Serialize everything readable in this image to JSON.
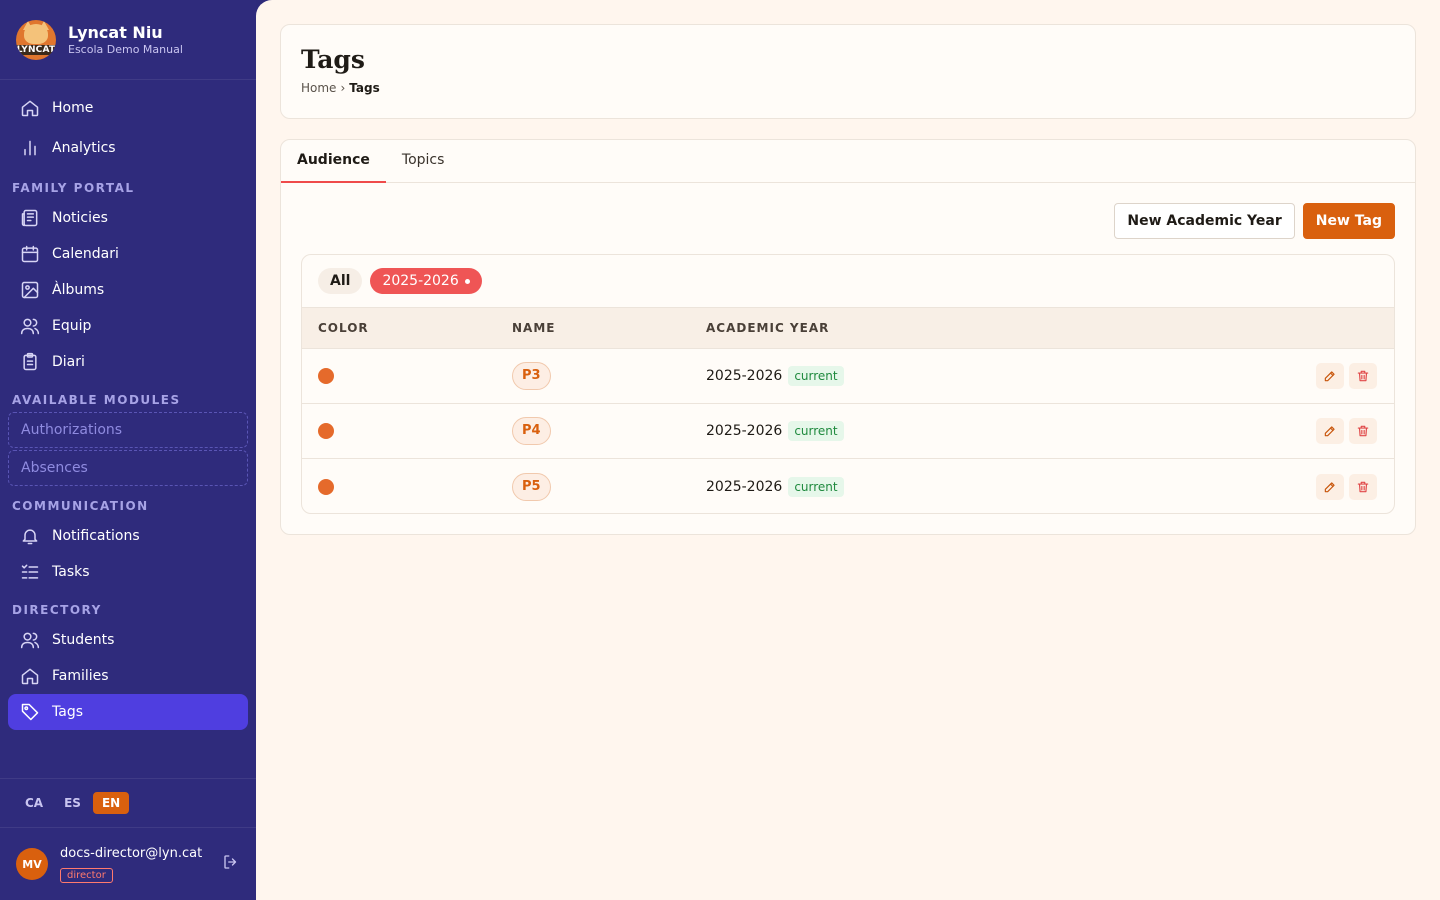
{
  "brand": {
    "logo_text": "LYNCAT",
    "title": "Lyncat Niu",
    "subtitle": "Escola Demo Manual"
  },
  "sidebar": {
    "top_items": [
      {
        "label": "Home",
        "icon": "home-icon"
      },
      {
        "label": "Analytics",
        "icon": "bar-chart-icon"
      }
    ],
    "sections": {
      "family_portal": {
        "label": "FAMILY PORTAL",
        "items": [
          {
            "label": "Noticies",
            "icon": "newspaper-icon"
          },
          {
            "label": "Calendari",
            "icon": "calendar-icon"
          },
          {
            "label": "Àlbums",
            "icon": "image-icon"
          },
          {
            "label": "Equip",
            "icon": "users-icon"
          },
          {
            "label": "Diari",
            "icon": "clipboard-icon"
          }
        ]
      },
      "available_modules": {
        "label": "AVAILABLE MODULES",
        "items": [
          {
            "label": "Authorizations"
          },
          {
            "label": "Absences"
          }
        ]
      },
      "communication": {
        "label": "COMMUNICATION",
        "items": [
          {
            "label": "Notifications",
            "icon": "bell-icon"
          },
          {
            "label": "Tasks",
            "icon": "checklist-icon"
          }
        ]
      },
      "directory": {
        "label": "DIRECTORY",
        "items": [
          {
            "label": "Students",
            "icon": "users-icon"
          },
          {
            "label": "Families",
            "icon": "home-icon"
          },
          {
            "label": "Tags",
            "icon": "tag-icon",
            "active": true
          }
        ]
      }
    },
    "languages": [
      "CA",
      "ES",
      "EN"
    ],
    "active_language": "EN",
    "user": {
      "initials": "MV",
      "email": "docs-director@lyn.cat",
      "role": "director"
    }
  },
  "header": {
    "title": "Tags",
    "breadcrumb": {
      "home": "Home",
      "separator": "›",
      "current": "Tags"
    }
  },
  "tabs": [
    {
      "label": "Audience",
      "active": true
    },
    {
      "label": "Topics",
      "active": false
    }
  ],
  "actions": {
    "new_year_label": "New Academic Year",
    "new_tag_label": "New Tag"
  },
  "filters": {
    "all_label": "All",
    "year_label": "2025-2026"
  },
  "table": {
    "columns": [
      "COLOR",
      "NAME",
      "ACADEMIC YEAR"
    ],
    "rows": [
      {
        "color": "#e56a2b",
        "name": "P3",
        "year": "2025-2026",
        "badge": "current"
      },
      {
        "color": "#e56a2b",
        "name": "P4",
        "year": "2025-2026",
        "badge": "current"
      },
      {
        "color": "#e56a2b",
        "name": "P5",
        "year": "2025-2026",
        "badge": "current"
      }
    ]
  },
  "colors": {
    "sidebar_bg": "#2f2b7c",
    "active_nav": "#4f3ee0",
    "brand_orange": "#d9600e",
    "accent_red": "#ef5555",
    "page_bg": "#fff6ee"
  }
}
